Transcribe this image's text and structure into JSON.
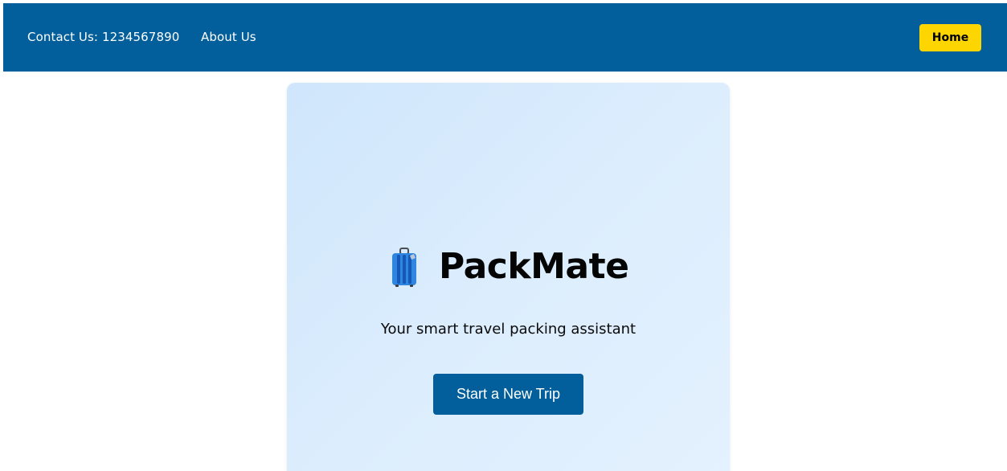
{
  "navbar": {
    "contact_label": "Contact Us: 1234567890",
    "about_label": "About Us",
    "home_label": "Home"
  },
  "hero": {
    "icon": "suitcase-icon",
    "title": "PackMate",
    "tagline": "Your smart travel packing assistant",
    "cta_label": "Start a New Trip"
  },
  "colors": {
    "navbar_bg": "#025f9b",
    "home_button_bg": "#fdd500",
    "cta_bg": "#025f9b",
    "card_bg": "#d8ebfc"
  }
}
